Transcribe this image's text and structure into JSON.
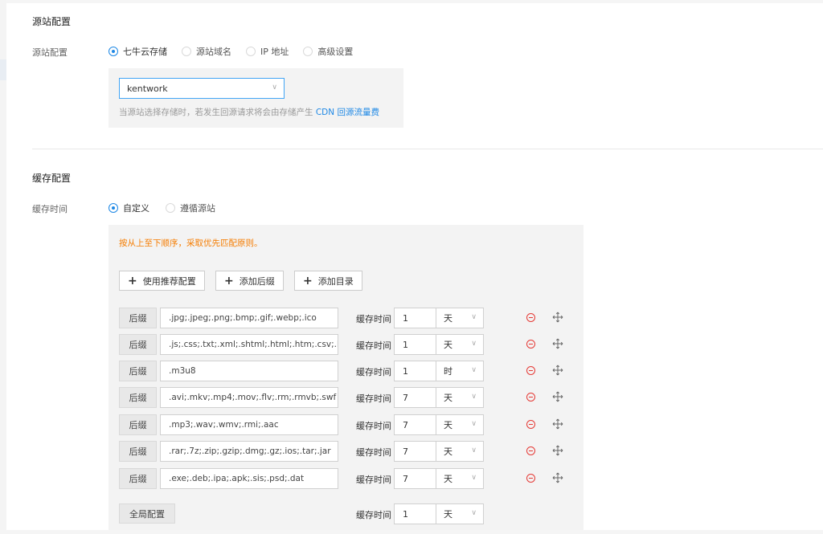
{
  "origin": {
    "section_title": "源站配置",
    "row_label": "源站配置",
    "options": [
      "七牛云存储",
      "源站域名",
      "IP 地址",
      "高级设置"
    ],
    "selected": "七牛云存储",
    "bucket_value": "kentwork",
    "hint_prefix": "当源站选择存储时，若发生回源请求将会由存储产生",
    "hint_link1": "CDN",
    "hint_link2": "回源流量费"
  },
  "cache": {
    "section_title": "缓存配置",
    "row_label": "缓存时间",
    "options": [
      "自定义",
      "遵循源站"
    ],
    "selected": "自定义",
    "note": "按从上至下顺序，采取优先匹配原则。",
    "buttons": {
      "recommend": "使用推荐配置",
      "add_suffix": "添加后缀",
      "add_dir": "添加目录"
    },
    "rule_time_label": "缓存时间",
    "rules": [
      {
        "tag": "后缀",
        "pattern": ".jpg;.jpeg;.png;.bmp;.gif;.webp;.ico",
        "value": "1",
        "unit": "天"
      },
      {
        "tag": "后缀",
        "pattern": ".js;.css;.txt;.xml;.shtml;.html;.htm;.csv;.ba",
        "value": "1",
        "unit": "天"
      },
      {
        "tag": "后缀",
        "pattern": ".m3u8",
        "value": "1",
        "unit": "时"
      },
      {
        "tag": "后缀",
        "pattern": ".avi;.mkv;.mp4;.mov;.flv;.rm;.rmvb;.swf",
        "value": "7",
        "unit": "天"
      },
      {
        "tag": "后缀",
        "pattern": ".mp3;.wav;.wmv;.rmi;.aac",
        "value": "7",
        "unit": "天"
      },
      {
        "tag": "后缀",
        "pattern": ".rar;.7z;.zip;.gzip;.dmg;.gz;.ios;.tar;.jar",
        "value": "7",
        "unit": "天"
      },
      {
        "tag": "后缀",
        "pattern": ".exe;.deb;.ipa;.apk;.sis;.psd;.dat",
        "value": "7",
        "unit": "天"
      }
    ],
    "global": {
      "label": "全局配置",
      "value": "1",
      "unit": "天"
    }
  },
  "colors": {
    "accent": "#1e88e5",
    "warning": "#f57c00",
    "danger": "#e53935"
  }
}
